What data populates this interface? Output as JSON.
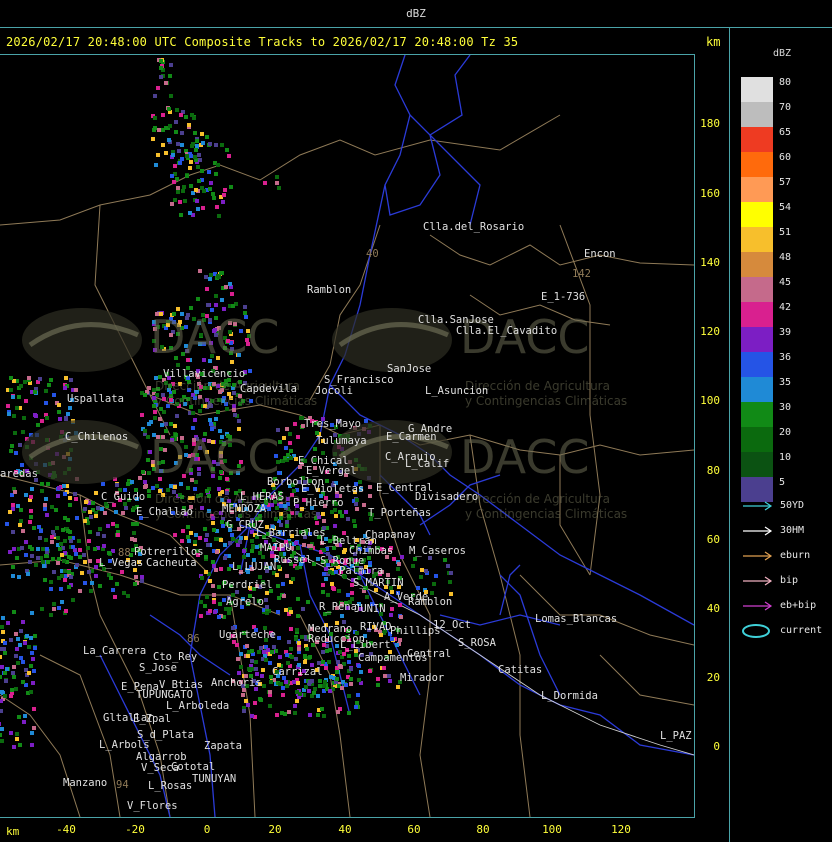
{
  "window": {
    "title": "dBZ"
  },
  "header": {
    "text": "2026/02/17 20:48:00 UTC Composite Tracks to 2026/02/17 20:48:00 Tz 35",
    "km_label": "km"
  },
  "axes": {
    "km_bottom_label": "km",
    "y_ticks": [
      "180",
      "160",
      "140",
      "120",
      "100",
      "80",
      "60",
      "40",
      "20",
      "0"
    ],
    "x_ticks": [
      "-40",
      "-20",
      "0",
      "20",
      "40",
      "60",
      "80",
      "100",
      "120"
    ]
  },
  "legend": {
    "title": "dBZ",
    "scale": [
      {
        "label": "80",
        "color": "#e0e0e0"
      },
      {
        "label": "70",
        "color": "#bdbdbd"
      },
      {
        "label": "65",
        "color": "#ee3b22"
      },
      {
        "label": "60",
        "color": "#ff6a0c"
      },
      {
        "label": "57",
        "color": "#ff9a55"
      },
      {
        "label": "54",
        "color": "#ffff00"
      },
      {
        "label": "51",
        "color": "#f7bf2c"
      },
      {
        "label": "48",
        "color": "#d68a3c"
      },
      {
        "label": "45",
        "color": "#c56a8b"
      },
      {
        "label": "42",
        "color": "#d9208f"
      },
      {
        "label": "39",
        "color": "#7c1ec4"
      },
      {
        "label": "36",
        "color": "#2554e6"
      },
      {
        "label": "35",
        "color": "#1f8ad6"
      },
      {
        "label": "30",
        "color": "#118a16"
      },
      {
        "label": "20",
        "color": "#0b6a0e"
      },
      {
        "label": "10",
        "color": "#0b5212"
      },
      {
        "label": "5",
        "color": "#4b3f8f"
      }
    ],
    "tracks": [
      {
        "label": "50YD",
        "color": "#3fd0d8"
      },
      {
        "label": "30HM",
        "color": "#ffffff"
      },
      {
        "label": "eburn",
        "color": "#e0a050"
      },
      {
        "label": "bip",
        "color": "#f0b0c0"
      },
      {
        "label": "eb+bip",
        "color": "#d040d0"
      },
      {
        "label": "current",
        "color": "#3fd0d8"
      }
    ]
  },
  "watermark": {
    "brand": "DACC",
    "line1": "Dirección de Agricultura",
    "line2": "y Contingencias Climáticas"
  },
  "places": [
    {
      "name": "Clla.del_Rosario"
    },
    {
      "name": "Encon"
    },
    {
      "name": "142"
    },
    {
      "name": "E_1-736"
    },
    {
      "name": "Ramblon"
    },
    {
      "name": "Clla.SanJose"
    },
    {
      "name": "Clla.El_Cavadito"
    },
    {
      "name": "Villavicencio"
    },
    {
      "name": "Capdevila"
    },
    {
      "name": "Uspallata"
    },
    {
      "name": "S_Francisco"
    },
    {
      "name": "Jocoli"
    },
    {
      "name": "SanJose"
    },
    {
      "name": "L_Asuncion"
    },
    {
      "name": "C_Chilenos"
    },
    {
      "name": "Tres_Mayo"
    },
    {
      "name": "Tulumaya"
    },
    {
      "name": "G_Andre"
    },
    {
      "name": "E_Carmen"
    },
    {
      "name": "C_Araujo"
    },
    {
      "name": "L_Calif"
    },
    {
      "name": "E_Chical"
    },
    {
      "name": "E_Vergel"
    },
    {
      "name": "aredas"
    },
    {
      "name": "Borbollon"
    },
    {
      "name": "E_Violetas"
    },
    {
      "name": "E_Central"
    },
    {
      "name": "Divisadero"
    },
    {
      "name": "C_Guido"
    },
    {
      "name": "L_HERAS"
    },
    {
      "name": "P_Hierro"
    },
    {
      "name": "E_Challao"
    },
    {
      "name": "MENDOZA"
    },
    {
      "name": "T_Porteñas"
    },
    {
      "name": "G_CRUZ"
    },
    {
      "name": "L_Barriales"
    },
    {
      "name": "Chapanay"
    },
    {
      "name": "L_Beltran"
    },
    {
      "name": "Potrerillos"
    },
    {
      "name": "MAIPU"
    },
    {
      "name": "Chimbas"
    },
    {
      "name": "M_Caseros"
    },
    {
      "name": "L_Vegas"
    },
    {
      "name": "Cacheuta"
    },
    {
      "name": "Russel"
    },
    {
      "name": "S_Roque"
    },
    {
      "name": "L_LUJAN"
    },
    {
      "name": "Palmira"
    },
    {
      "name": "Perdriel"
    },
    {
      "name": "S_MARTIN"
    },
    {
      "name": "A_Verde"
    },
    {
      "name": "Agrelo"
    },
    {
      "name": "R_Pena"
    },
    {
      "name": "JUNIN"
    },
    {
      "name": "Ramblon"
    },
    {
      "name": "Lomas_Blancas"
    },
    {
      "name": "Ugarteche"
    },
    {
      "name": "Medrano"
    },
    {
      "name": "RIVAD"
    },
    {
      "name": "Phillips"
    },
    {
      "name": "12_Oct"
    },
    {
      "name": "Reduccion"
    },
    {
      "name": "S_ROSA"
    },
    {
      "name": "La_Carrera"
    },
    {
      "name": "Cto_Rey"
    },
    {
      "name": "L_Libert"
    },
    {
      "name": "Campamentos"
    },
    {
      "name": "Central"
    },
    {
      "name": "S_Jose"
    },
    {
      "name": "Catitas"
    },
    {
      "name": "Carrizal"
    },
    {
      "name": "Anchoris"
    },
    {
      "name": "E_Pena"
    },
    {
      "name": "V_Btias"
    },
    {
      "name": "Mirador"
    },
    {
      "name": "TUPUNGATO"
    },
    {
      "name": "L_Dormida"
    },
    {
      "name": "L_Arboleda"
    },
    {
      "name": "Gltallar"
    },
    {
      "name": "E_Zpal"
    },
    {
      "name": "S_d_Plata"
    },
    {
      "name": "L_PAZ"
    },
    {
      "name": "L_Arbols"
    },
    {
      "name": "Zapata"
    },
    {
      "name": "Algarrob"
    },
    {
      "name": "V_Seca"
    },
    {
      "name": "Cototal"
    },
    {
      "name": "TUNUYAN"
    },
    {
      "name": "Manzano"
    },
    {
      "name": "L_Rosas"
    },
    {
      "name": "V_Flores"
    },
    {
      "name": "88"
    },
    {
      "name": "86"
    },
    {
      "name": "94"
    },
    {
      "name": "40"
    }
  ]
}
